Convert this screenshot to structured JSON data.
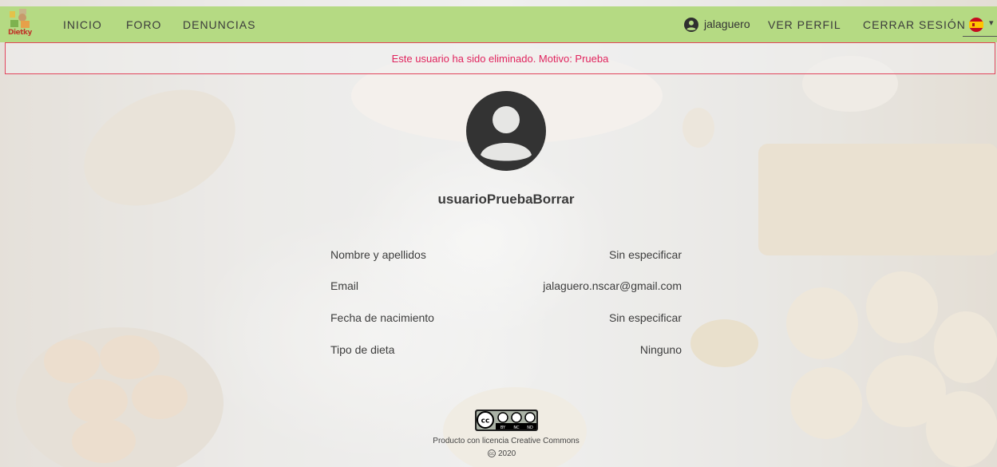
{
  "navbar": {
    "logo_text": "Dietky",
    "links": [
      "INICIO",
      "FORO",
      "DENUNCIAS"
    ],
    "username": "jalaguero",
    "ver_perfil": "VER PERFIL",
    "cerrar_sesion": "CERRAR SESIÓN",
    "language_icon": "spain-flag-icon",
    "user_icon": "account-circle-icon"
  },
  "alert": {
    "text": "Este usuario ha sido eliminado. Motivo: Prueba"
  },
  "profile": {
    "avatar_icon": "account-circle-icon",
    "name": "usuarioPruebaBorrar",
    "fields": [
      {
        "label": "Nombre y apellidos",
        "value": "Sin especificar"
      },
      {
        "label": "Email",
        "value": "jalaguero.nscar@gmail.com"
      },
      {
        "label": "Fecha de nacimiento",
        "value": "Sin especificar"
      },
      {
        "label": "Tipo de dieta",
        "value": "Ninguno"
      }
    ]
  },
  "footer": {
    "license_icon": "cc-by-nc-nd-badge",
    "text": "Producto con licencia Creative Commons",
    "cc_symbol": "cc",
    "year": "2020"
  },
  "colors": {
    "navbar": "#b5da83",
    "alert": "#e0245e",
    "avatar": "#333333"
  }
}
